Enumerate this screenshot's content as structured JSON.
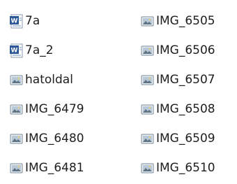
{
  "files": [
    {
      "name": "7a",
      "icon": "word-document-icon"
    },
    {
      "name": "7a_2",
      "icon": "word-document-icon"
    },
    {
      "name": "hatoldal",
      "icon": "image-file-icon"
    },
    {
      "name": "IMG_6479",
      "icon": "image-file-icon"
    },
    {
      "name": "IMG_6480",
      "icon": "image-file-icon"
    },
    {
      "name": "IMG_6481",
      "icon": "image-file-icon"
    },
    {
      "name": "IMG_6505",
      "icon": "image-file-icon"
    },
    {
      "name": "IMG_6506",
      "icon": "image-file-icon"
    },
    {
      "name": "IMG_6507",
      "icon": "image-file-icon"
    },
    {
      "name": "IMG_6508",
      "icon": "image-file-icon"
    },
    {
      "name": "IMG_6509",
      "icon": "image-file-icon"
    },
    {
      "name": "IMG_6510",
      "icon": "image-file-icon"
    }
  ],
  "colors": {
    "word_blue": "#2b5797",
    "image_frame": "#7a8a9a",
    "image_fill": "#b9c8d6",
    "text": "#1e1e1e"
  }
}
